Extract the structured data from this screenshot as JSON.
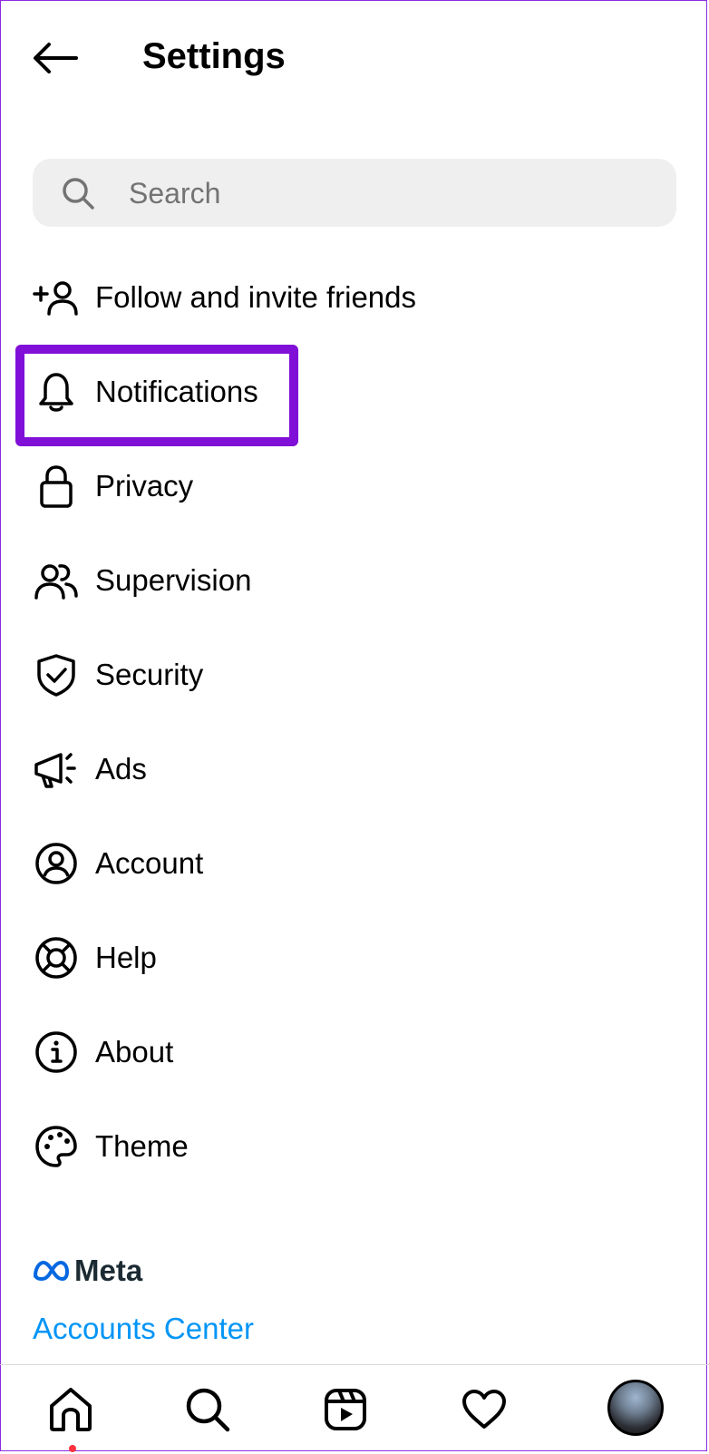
{
  "header": {
    "title": "Settings",
    "back_icon": "arrow-left-icon"
  },
  "search": {
    "placeholder": "Search",
    "value": "",
    "icon": "search-icon"
  },
  "menu": {
    "items": [
      {
        "label": "Follow and invite friends",
        "icon": "add-person-icon"
      },
      {
        "label": "Notifications",
        "icon": "bell-icon"
      },
      {
        "label": "Privacy",
        "icon": "lock-icon"
      },
      {
        "label": "Supervision",
        "icon": "people-icon"
      },
      {
        "label": "Security",
        "icon": "shield-check-icon"
      },
      {
        "label": "Ads",
        "icon": "megaphone-icon"
      },
      {
        "label": "Account",
        "icon": "account-circle-icon"
      },
      {
        "label": "Help",
        "icon": "lifebuoy-icon"
      },
      {
        "label": "About",
        "icon": "info-icon"
      },
      {
        "label": "Theme",
        "icon": "palette-icon"
      }
    ]
  },
  "meta": {
    "brand": "Meta",
    "accounts_center": "Accounts Center"
  },
  "nav": {
    "items": [
      "home-icon",
      "search-icon",
      "reels-icon",
      "heart-icon",
      "profile-avatar"
    ],
    "active": "home",
    "home_has_notification_dot": true
  },
  "colors": {
    "highlight": "#8010d8",
    "link": "#0095f6",
    "search_bg": "#efefef",
    "notification_dot": "#ff3040"
  }
}
